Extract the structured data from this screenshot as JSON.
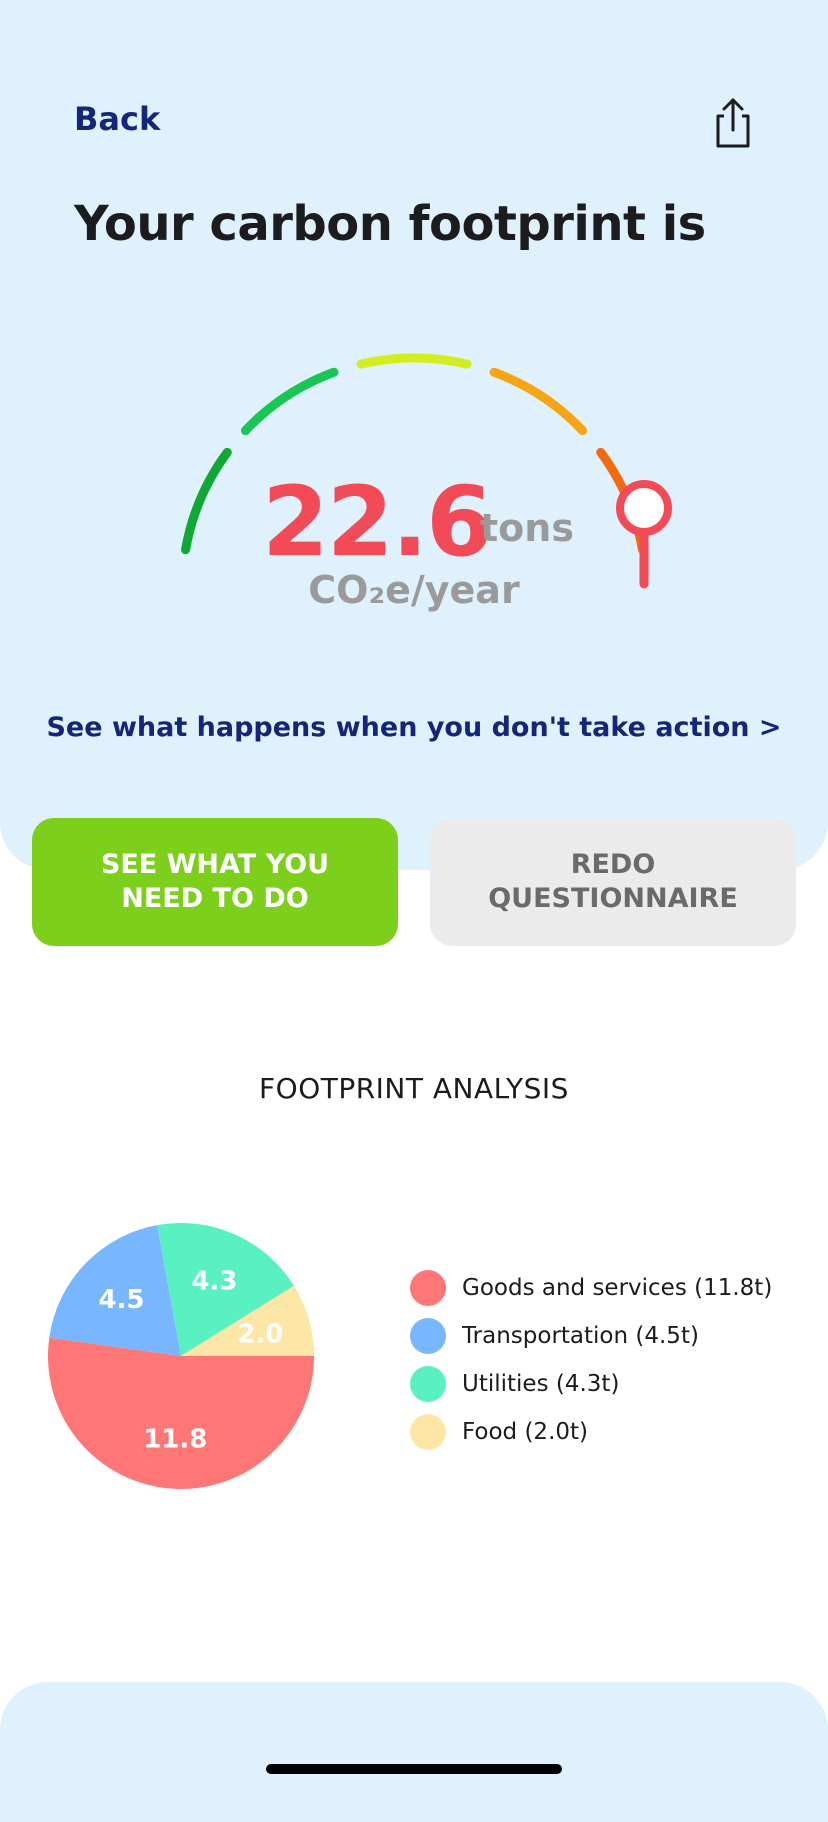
{
  "header": {
    "back_label": "Back",
    "share_icon": "share-icon"
  },
  "title": "Your carbon footprint is",
  "gauge": {
    "value": "22.6",
    "unit": "tons",
    "per_label": "CO₂e/year",
    "segment_colors": [
      "#0fa833",
      "#17c653",
      "#d2ee1e",
      "#f5a516",
      "#f46a12"
    ],
    "marker_color": "#f24a56",
    "level": 1.0
  },
  "action_link": "See what happens when you don't take action >",
  "buttons": {
    "primary_label": "SEE WHAT YOU\nNEED TO DO",
    "secondary_label": "REDO\nQUESTIONNAIRE"
  },
  "analysis": {
    "title": "FOOTPRINT ANALYSIS",
    "legend": [
      {
        "label": "Goods and services (11.8t)",
        "color": "#ff7676"
      },
      {
        "label": "Transportation (4.5t)",
        "color": "#78b6ff"
      },
      {
        "label": "Utilities (4.3t)",
        "color": "#59f0c2"
      },
      {
        "label": "Food (2.0t)",
        "color": "#fde6a6"
      }
    ]
  },
  "chart_data": {
    "type": "pie",
    "title": "",
    "categories": [
      "Goods and services",
      "Transportation",
      "Utilities",
      "Food"
    ],
    "values": [
      11.8,
      4.5,
      4.3,
      2.0
    ],
    "data_labels": [
      "11.8",
      "4.5",
      "4.3",
      "2.0"
    ],
    "colors": [
      "#ff7676",
      "#78b6ff",
      "#59f0c2",
      "#fde6a6"
    ],
    "legend_placement": "right"
  }
}
